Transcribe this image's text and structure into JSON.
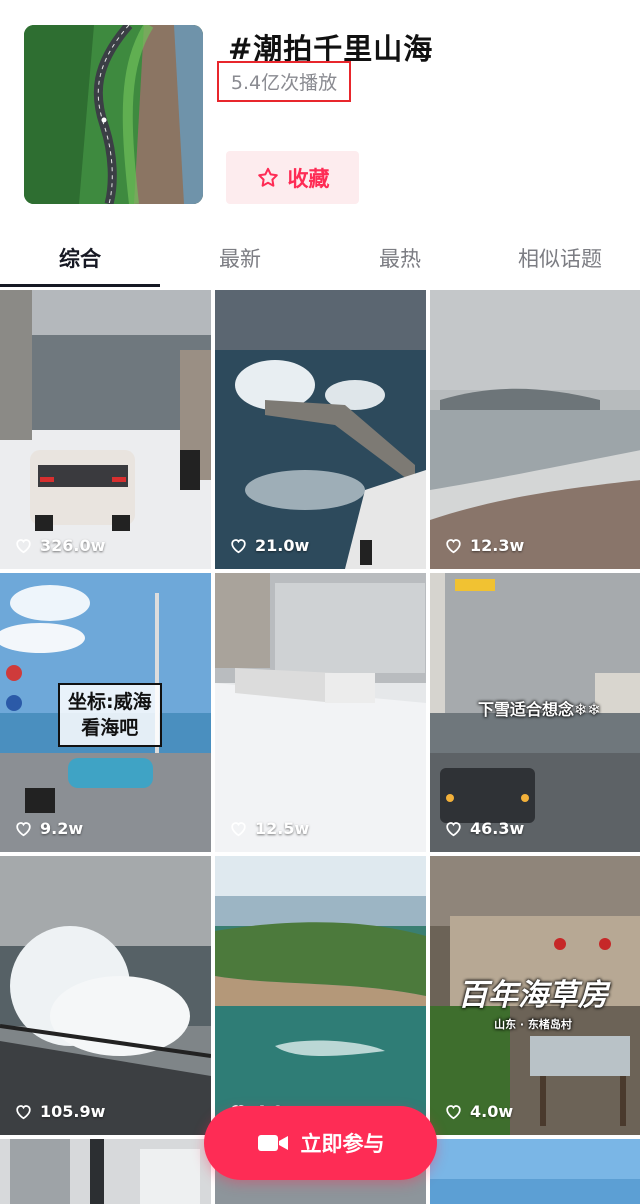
{
  "topic": {
    "title": "#潮拍千里山海",
    "plays": "5.4亿次播放",
    "favorite_label": "收藏"
  },
  "tabs": [
    {
      "label": "综合",
      "active": true
    },
    {
      "label": "最新",
      "active": false
    },
    {
      "label": "最热",
      "active": false
    },
    {
      "label": "相似话题",
      "active": false
    }
  ],
  "videos": [
    {
      "likes": "326.0w",
      "scene": "snowy-street-car-sea"
    },
    {
      "likes": "21.0w",
      "scene": "pier-storm-waves"
    },
    {
      "likes": "12.3w",
      "scene": "misty-beach"
    },
    {
      "likes": "9.2w",
      "scene": "weihai-street-sign",
      "overlay": [
        "坐标:威海",
        "看海吧"
      ]
    },
    {
      "likes": "12.5w",
      "scene": "snowy-stairs"
    },
    {
      "likes": "46.3w",
      "scene": "snowing-street",
      "overlay": [
        "下雪适合想念❄❄"
      ]
    },
    {
      "likes": "105.9w",
      "scene": "big-wave-pier"
    },
    {
      "likes": "4.0w",
      "scene": "coastal-aerial"
    },
    {
      "likes": "4.0w",
      "scene": "seaweed-house",
      "overlay": [
        "百年海草房",
        "山东 · 东楮岛村"
      ]
    }
  ],
  "cta": {
    "label": "立即参与",
    "icon": "video-camera-icon"
  },
  "colors": {
    "accent": "#fe2c55",
    "highlight_box": "#e8262c"
  }
}
